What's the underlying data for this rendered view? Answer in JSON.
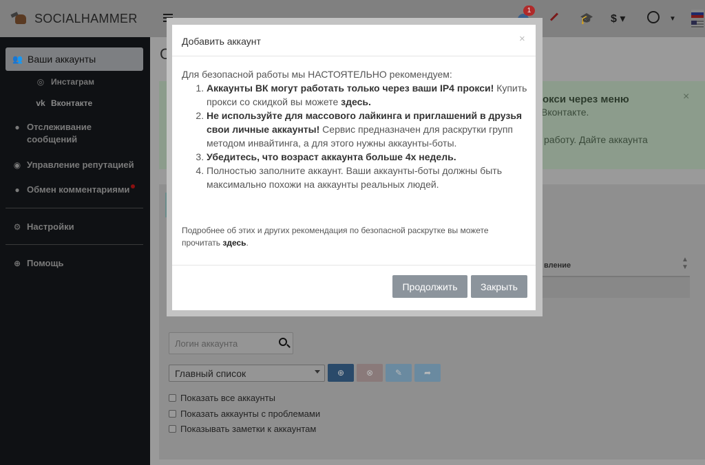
{
  "app": {
    "brand": "SOCIALHAMMER"
  },
  "topbar": {
    "notification_count": "1",
    "currency": "$"
  },
  "sidebar": {
    "accounts": "Ваши аккаунты",
    "instagram": "Инстаграм",
    "vkontakte": "Вконтакте",
    "tracking": "Отслеживание сообщений",
    "reputation": "Управление репутацией",
    "comments": "Обмен комментариями",
    "settings": "Настройки",
    "help": "Помощь"
  },
  "main": {
    "title": "Сп",
    "alert_line1": "окси через меню",
    "alert_line2": "Вконтакте.",
    "alert_line3": "работу. Дайте аккаунта",
    "table_header": "вление",
    "search_placeholder": "Логин аккаунта",
    "list_select": "Главный список",
    "checkbox_all": "Показать все аккаунты",
    "checkbox_problems": "Показать аккаунты с проблемами",
    "checkbox_notes": "Показывать заметки к аккаунтам"
  },
  "modal": {
    "title": "Добавить аккаунт",
    "close_x": "×",
    "intro": "Для безопасной работы мы НАСТОЯТЕЛЬНО рекомендуем:",
    "item1_bold": "Аккаунты ВК могут работать только через ваши IP4 прокси!",
    "item1_text": "Купить прокси со скидкой вы можете ",
    "item1_link": "здесь.",
    "item2_bold": "Не используйте для массового лайкинга и приглашений в друзья свои личные аккаунты!",
    "item2_text": " Сервис предназначен для раскрутки групп методом инвайтинга, а для этого нужны аккаунты-боты.",
    "item3_bold": "Убедитесь, что возраст аккаунта больше 4х недель.",
    "item4_text": "Полностью заполните аккаунт. Ваши аккаунты-боты должны быть максимально похожи на аккаунты реальных людей.",
    "note_text": "Подробнее об этих и других рекомендация по безопасной раскрутке вы можете прочитать ",
    "note_link": "здесь",
    "note_end": ".",
    "btn_continue": "Продолжить",
    "btn_close": "Закрыть"
  }
}
